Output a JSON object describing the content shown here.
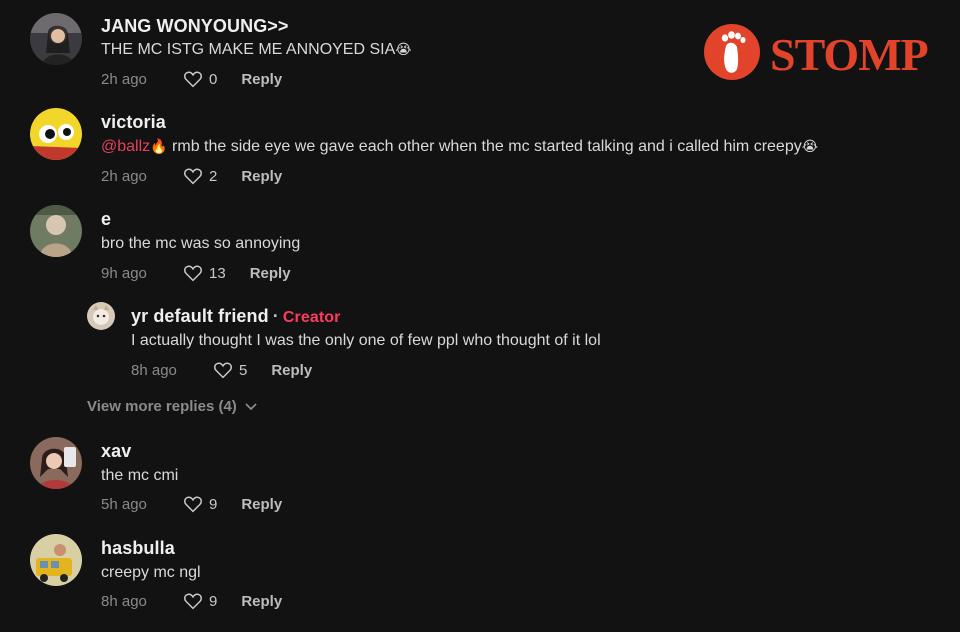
{
  "watermark": {
    "text": "STOMP",
    "color": "#e1442a"
  },
  "comments": [
    {
      "username": "JANG WONYOUNG>>",
      "text": "THE MC ISTG MAKE ME ANNOYED SIA",
      "emoji": "😭",
      "time": "2h ago",
      "likes": "0",
      "reply": "Reply"
    },
    {
      "username": "victoria",
      "mention": "@ballz",
      "mention_emoji": "🔥",
      "text": " rmb the side eye we gave each other when the mc started talking and i called him creepy",
      "emoji": "😭",
      "time": "2h ago",
      "likes": "2",
      "reply": "Reply"
    },
    {
      "username": "e",
      "text": "bro the mc was so annoying",
      "time": "9h ago",
      "likes": "13",
      "reply": "Reply"
    },
    {
      "username": "xav",
      "text": "the mc cmi",
      "time": "5h ago",
      "likes": "9",
      "reply": "Reply"
    },
    {
      "username": "hasbulla",
      "text": "creepy mc ngl",
      "time": "8h ago",
      "likes": "9",
      "reply": "Reply"
    }
  ],
  "reply_thread": {
    "username": "yr default friend",
    "separator": "·",
    "badge": "Creator",
    "text": "I actually thought I was the only one of few ppl who thought of it lol",
    "time": "8h ago",
    "likes": "5",
    "reply": "Reply"
  },
  "view_more": "View more replies (4)",
  "colors": {
    "background": "#121212",
    "mention": "#e4405f",
    "creator_badge": "#ff3b5c",
    "meta_gray": "#8a8a8a"
  },
  "icons": {
    "like": "heart-outline-icon",
    "expand": "chevron-down-icon",
    "logo": "footprint-icon"
  }
}
